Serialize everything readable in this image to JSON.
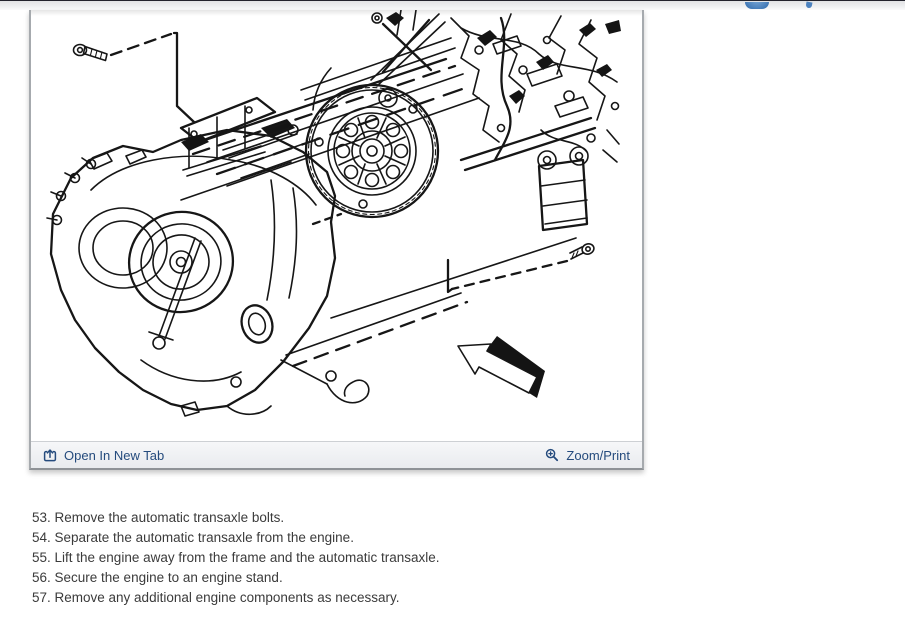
{
  "top_strip": {
    "icons": [
      {
        "name": "blue-circle-icon-fragment",
        "color": "#3f77b5"
      },
      {
        "name": "blue-glyph-icon-fragment",
        "color": "#4c82bf"
      }
    ]
  },
  "viewer_panel": {
    "image_description": "Exploded line drawing of engine being separated from the automatic transaxle, with transaxle bolts and removal-direction arrow",
    "toolbar": {
      "open_in_new_tab_label": "Open In New Tab",
      "zoom_print_label": "Zoom/Print",
      "link_color": "#254b7d"
    }
  },
  "steps": {
    "items": [
      "53. Remove the automatic transaxle bolts.",
      "54. Separate the automatic transaxle from the engine.",
      "55. Lift the engine away from the frame and the automatic transaxle.",
      "56. Secure the engine to an engine stand.",
      "57. Remove any additional engine components as necessary."
    ],
    "text_color": "#3b3b3b"
  }
}
